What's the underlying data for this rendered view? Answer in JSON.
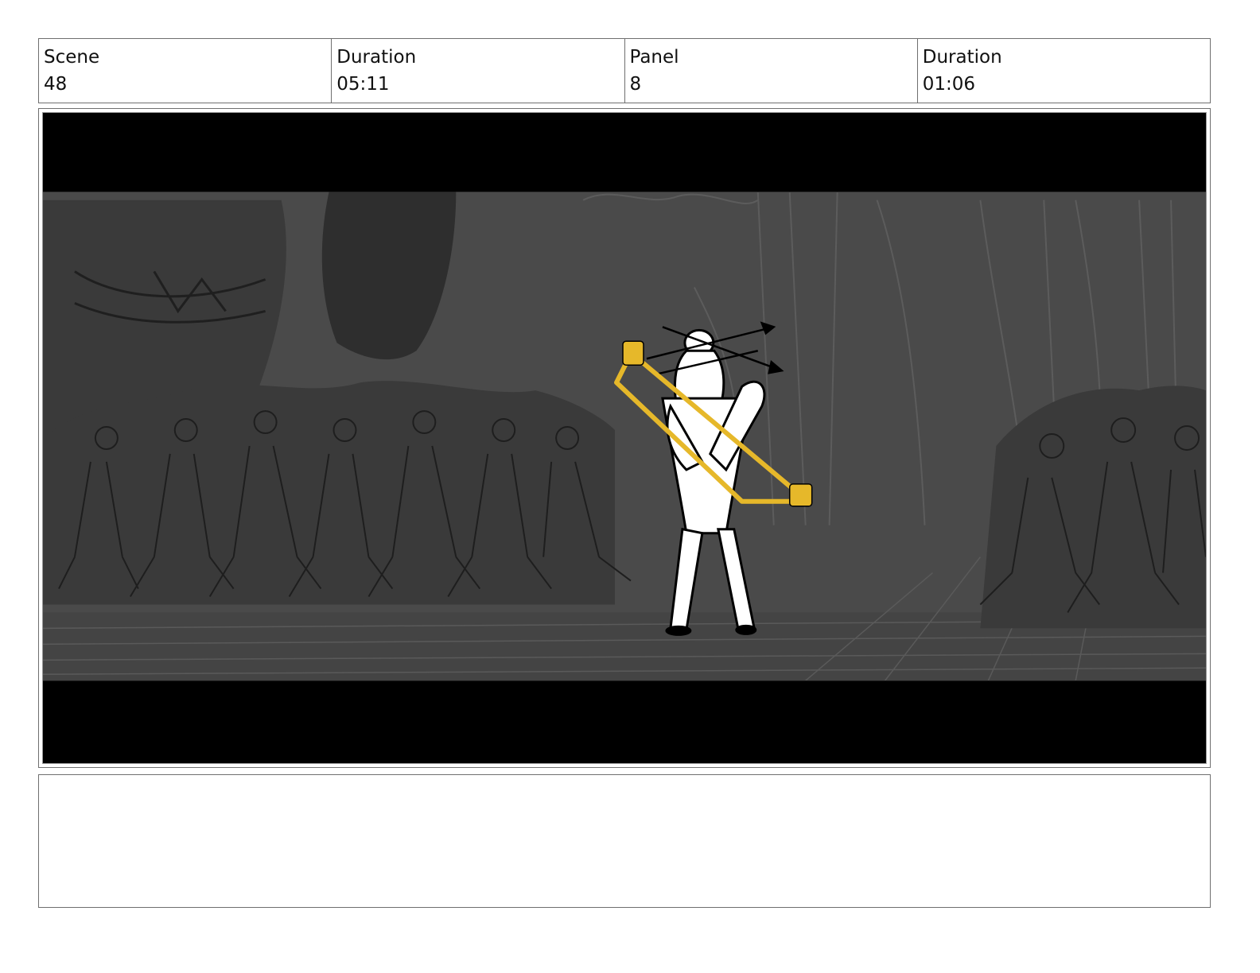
{
  "header": {
    "cells": [
      {
        "label": "Scene",
        "value": "48"
      },
      {
        "label": "Duration",
        "value": "05:11"
      },
      {
        "label": "Panel",
        "value": "8"
      },
      {
        "label": "Duration",
        "value": "01:06"
      }
    ]
  },
  "panel": {
    "colors": {
      "letterbox": "#000000",
      "background": "#4a4a4a",
      "crowd": "#3a3a3a",
      "line": "#1e1e1e",
      "figure": "#ffffff",
      "highlight": "#e6b82a"
    },
    "icon": "storyboard-sketch-image"
  },
  "notes": {
    "text": ""
  }
}
